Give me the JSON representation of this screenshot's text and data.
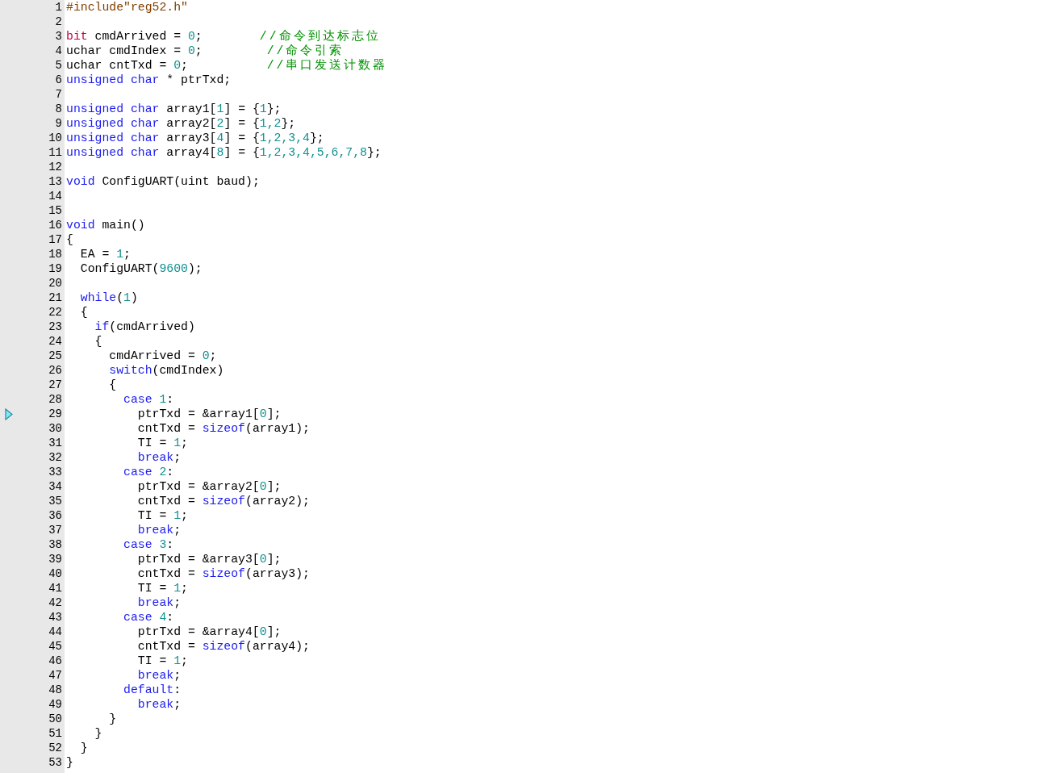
{
  "lines": [
    {
      "number": "1",
      "current": false,
      "tokens": [
        {
          "text": "#include\"reg52.h\"",
          "kind": "directive"
        }
      ]
    },
    {
      "number": "2",
      "current": false
    },
    {
      "number": "3",
      "current": false,
      "tokens": [
        {
          "text": "bit",
          "kind": "type"
        },
        {
          "text": " cmdArrived = ",
          "kind": "plain"
        },
        {
          "text": "0",
          "kind": "number"
        },
        {
          "text": ";        ",
          "kind": "plain"
        },
        {
          "text": "//命令到达标志位",
          "kind": "comment"
        }
      ]
    },
    {
      "number": "4",
      "current": false,
      "tokens": [
        {
          "text": "uchar cmdIndex = ",
          "kind": "plain"
        },
        {
          "text": "0",
          "kind": "number"
        },
        {
          "text": ";         ",
          "kind": "plain"
        },
        {
          "text": "//命令引索",
          "kind": "comment"
        }
      ]
    },
    {
      "number": "5",
      "current": false,
      "tokens": [
        {
          "text": "uchar cntTxd = ",
          "kind": "plain"
        },
        {
          "text": "0",
          "kind": "number"
        },
        {
          "text": ";           ",
          "kind": "plain"
        },
        {
          "text": "//串口发送计数器",
          "kind": "comment"
        }
      ]
    },
    {
      "number": "6",
      "current": false,
      "tokens": [
        {
          "text": "unsigned char",
          "kind": "keyword"
        },
        {
          "text": " * ptrTxd;",
          "kind": "plain"
        }
      ]
    },
    {
      "number": "7",
      "current": false
    },
    {
      "number": "8",
      "current": false,
      "tokens": [
        {
          "text": "unsigned char",
          "kind": "keyword"
        },
        {
          "text": " array1[",
          "kind": "plain"
        },
        {
          "text": "1",
          "kind": "number"
        },
        {
          "text": "] = {",
          "kind": "plain"
        },
        {
          "text": "1",
          "kind": "number"
        },
        {
          "text": "};",
          "kind": "plain"
        }
      ]
    },
    {
      "number": "9",
      "current": false,
      "tokens": [
        {
          "text": "unsigned char",
          "kind": "keyword"
        },
        {
          "text": " array2[",
          "kind": "plain"
        },
        {
          "text": "2",
          "kind": "number"
        },
        {
          "text": "] = {",
          "kind": "plain"
        },
        {
          "text": "1,2",
          "kind": "number"
        },
        {
          "text": "};",
          "kind": "plain"
        }
      ]
    },
    {
      "number": "10",
      "current": false,
      "tokens": [
        {
          "text": "unsigned char",
          "kind": "keyword"
        },
        {
          "text": " array3[",
          "kind": "plain"
        },
        {
          "text": "4",
          "kind": "number"
        },
        {
          "text": "] = {",
          "kind": "plain"
        },
        {
          "text": "1,2,3,4",
          "kind": "number"
        },
        {
          "text": "};",
          "kind": "plain"
        }
      ]
    },
    {
      "number": "11",
      "current": false,
      "tokens": [
        {
          "text": "unsigned char",
          "kind": "keyword"
        },
        {
          "text": " array4[",
          "kind": "plain"
        },
        {
          "text": "8",
          "kind": "number"
        },
        {
          "text": "] = {",
          "kind": "plain"
        },
        {
          "text": "1,2,3,4,5,6,7,8",
          "kind": "number"
        },
        {
          "text": "};",
          "kind": "plain"
        }
      ]
    },
    {
      "number": "12",
      "current": false
    },
    {
      "number": "13",
      "current": false,
      "tokens": [
        {
          "text": "void",
          "kind": "keyword"
        },
        {
          "text": " ConfigUART(uint baud);",
          "kind": "plain"
        }
      ]
    },
    {
      "number": "14",
      "current": false
    },
    {
      "number": "15",
      "current": false
    },
    {
      "number": "16",
      "current": false,
      "tokens": [
        {
          "text": "void",
          "kind": "keyword"
        },
        {
          "text": " main()",
          "kind": "plain"
        }
      ]
    },
    {
      "number": "17",
      "current": false,
      "tokens": [
        {
          "text": "{",
          "kind": "plain"
        }
      ]
    },
    {
      "number": "18",
      "current": false,
      "tokens": [
        {
          "text": "  EA = ",
          "kind": "plain"
        },
        {
          "text": "1",
          "kind": "number"
        },
        {
          "text": ";",
          "kind": "plain"
        }
      ]
    },
    {
      "number": "19",
      "current": false,
      "tokens": [
        {
          "text": "  ConfigUART(",
          "kind": "plain"
        },
        {
          "text": "9600",
          "kind": "number"
        },
        {
          "text": ");",
          "kind": "plain"
        }
      ]
    },
    {
      "number": "20",
      "current": false
    },
    {
      "number": "21",
      "current": false,
      "tokens": [
        {
          "text": "  while",
          "kind": "keyword"
        },
        {
          "text": "(",
          "kind": "plain"
        },
        {
          "text": "1",
          "kind": "number"
        },
        {
          "text": ")",
          "kind": "plain"
        }
      ]
    },
    {
      "number": "22",
      "current": false,
      "tokens": [
        {
          "text": "  {",
          "kind": "plain"
        }
      ]
    },
    {
      "number": "23",
      "current": false,
      "tokens": [
        {
          "text": "    if",
          "kind": "keyword"
        },
        {
          "text": "(cmdArrived)",
          "kind": "plain"
        }
      ]
    },
    {
      "number": "24",
      "current": false,
      "tokens": [
        {
          "text": "    {",
          "kind": "plain"
        }
      ]
    },
    {
      "number": "25",
      "current": false,
      "tokens": [
        {
          "text": "      cmdArrived = ",
          "kind": "plain"
        },
        {
          "text": "0",
          "kind": "number"
        },
        {
          "text": ";",
          "kind": "plain"
        }
      ]
    },
    {
      "number": "26",
      "current": false,
      "tokens": [
        {
          "text": "      switch",
          "kind": "keyword"
        },
        {
          "text": "(cmdIndex)",
          "kind": "plain"
        }
      ]
    },
    {
      "number": "27",
      "current": false,
      "tokens": [
        {
          "text": "      {",
          "kind": "plain"
        }
      ]
    },
    {
      "number": "28",
      "current": false,
      "tokens": [
        {
          "text": "        case",
          "kind": "keyword"
        },
        {
          "text": " 1",
          "kind": "number"
        },
        {
          "text": ":",
          "kind": "plain"
        }
      ]
    },
    {
      "number": "29",
      "current": true,
      "tokens": [
        {
          "text": "          ptrTxd = &array1[",
          "kind": "plain"
        },
        {
          "text": "0",
          "kind": "number"
        },
        {
          "text": "];",
          "kind": "plain"
        }
      ]
    },
    {
      "number": "30",
      "current": false,
      "tokens": [
        {
          "text": "          cntTxd = ",
          "kind": "plain"
        },
        {
          "text": "sizeof",
          "kind": "keyword"
        },
        {
          "text": "(array1);",
          "kind": "plain"
        }
      ]
    },
    {
      "number": "31",
      "current": false,
      "tokens": [
        {
          "text": "          TI = ",
          "kind": "plain"
        },
        {
          "text": "1",
          "kind": "number"
        },
        {
          "text": ";",
          "kind": "plain"
        }
      ]
    },
    {
      "number": "32",
      "current": false,
      "tokens": [
        {
          "text": "          break",
          "kind": "keyword"
        },
        {
          "text": ";",
          "kind": "plain"
        }
      ]
    },
    {
      "number": "33",
      "current": false,
      "tokens": [
        {
          "text": "        case",
          "kind": "keyword"
        },
        {
          "text": " 2",
          "kind": "number"
        },
        {
          "text": ":",
          "kind": "plain"
        }
      ]
    },
    {
      "number": "34",
      "current": false,
      "tokens": [
        {
          "text": "          ptrTxd = &array2[",
          "kind": "plain"
        },
        {
          "text": "0",
          "kind": "number"
        },
        {
          "text": "];",
          "kind": "plain"
        }
      ]
    },
    {
      "number": "35",
      "current": false,
      "tokens": [
        {
          "text": "          cntTxd = ",
          "kind": "plain"
        },
        {
          "text": "sizeof",
          "kind": "keyword"
        },
        {
          "text": "(array2);",
          "kind": "plain"
        }
      ]
    },
    {
      "number": "36",
      "current": false,
      "tokens": [
        {
          "text": "          TI = ",
          "kind": "plain"
        },
        {
          "text": "1",
          "kind": "number"
        },
        {
          "text": ";",
          "kind": "plain"
        }
      ]
    },
    {
      "number": "37",
      "current": false,
      "tokens": [
        {
          "text": "          break",
          "kind": "keyword"
        },
        {
          "text": ";",
          "kind": "plain"
        }
      ]
    },
    {
      "number": "38",
      "current": false,
      "tokens": [
        {
          "text": "        case",
          "kind": "keyword"
        },
        {
          "text": " 3",
          "kind": "number"
        },
        {
          "text": ":",
          "kind": "plain"
        }
      ]
    },
    {
      "number": "39",
      "current": false,
      "tokens": [
        {
          "text": "          ptrTxd = &array3[",
          "kind": "plain"
        },
        {
          "text": "0",
          "kind": "number"
        },
        {
          "text": "];",
          "kind": "plain"
        }
      ]
    },
    {
      "number": "40",
      "current": false,
      "tokens": [
        {
          "text": "          cntTxd = ",
          "kind": "plain"
        },
        {
          "text": "sizeof",
          "kind": "keyword"
        },
        {
          "text": "(array3);",
          "kind": "plain"
        }
      ]
    },
    {
      "number": "41",
      "current": false,
      "tokens": [
        {
          "text": "          TI = ",
          "kind": "plain"
        },
        {
          "text": "1",
          "kind": "number"
        },
        {
          "text": ";",
          "kind": "plain"
        }
      ]
    },
    {
      "number": "42",
      "current": false,
      "tokens": [
        {
          "text": "          break",
          "kind": "keyword"
        },
        {
          "text": ";",
          "kind": "plain"
        }
      ]
    },
    {
      "number": "43",
      "current": false,
      "tokens": [
        {
          "text": "        case",
          "kind": "keyword"
        },
        {
          "text": " 4",
          "kind": "number"
        },
        {
          "text": ":",
          "kind": "plain"
        }
      ]
    },
    {
      "number": "44",
      "current": false,
      "tokens": [
        {
          "text": "          ptrTxd = &array4[",
          "kind": "plain"
        },
        {
          "text": "0",
          "kind": "number"
        },
        {
          "text": "];",
          "kind": "plain"
        }
      ]
    },
    {
      "number": "45",
      "current": false,
      "tokens": [
        {
          "text": "          cntTxd = ",
          "kind": "plain"
        },
        {
          "text": "sizeof",
          "kind": "keyword"
        },
        {
          "text": "(array4);",
          "kind": "plain"
        }
      ]
    },
    {
      "number": "46",
      "current": false,
      "tokens": [
        {
          "text": "          TI = ",
          "kind": "plain"
        },
        {
          "text": "1",
          "kind": "number"
        },
        {
          "text": ";",
          "kind": "plain"
        }
      ]
    },
    {
      "number": "47",
      "current": false,
      "tokens": [
        {
          "text": "          break",
          "kind": "keyword"
        },
        {
          "text": ";",
          "kind": "plain"
        }
      ]
    },
    {
      "number": "48",
      "current": false,
      "tokens": [
        {
          "text": "        default",
          "kind": "keyword"
        },
        {
          "text": ":",
          "kind": "plain"
        }
      ]
    },
    {
      "number": "49",
      "current": false,
      "tokens": [
        {
          "text": "          break",
          "kind": "keyword"
        },
        {
          "text": ";",
          "kind": "plain"
        }
      ]
    },
    {
      "number": "50",
      "current": false,
      "tokens": [
        {
          "text": "      }",
          "kind": "plain"
        }
      ]
    },
    {
      "number": "51",
      "current": false,
      "tokens": [
        {
          "text": "    }",
          "kind": "plain"
        }
      ]
    },
    {
      "number": "52",
      "current": false,
      "tokens": [
        {
          "text": "  }",
          "kind": "plain"
        }
      ]
    },
    {
      "number": "53",
      "current": false,
      "tokens": [
        {
          "text": "}",
          "kind": "plain"
        }
      ]
    }
  ]
}
